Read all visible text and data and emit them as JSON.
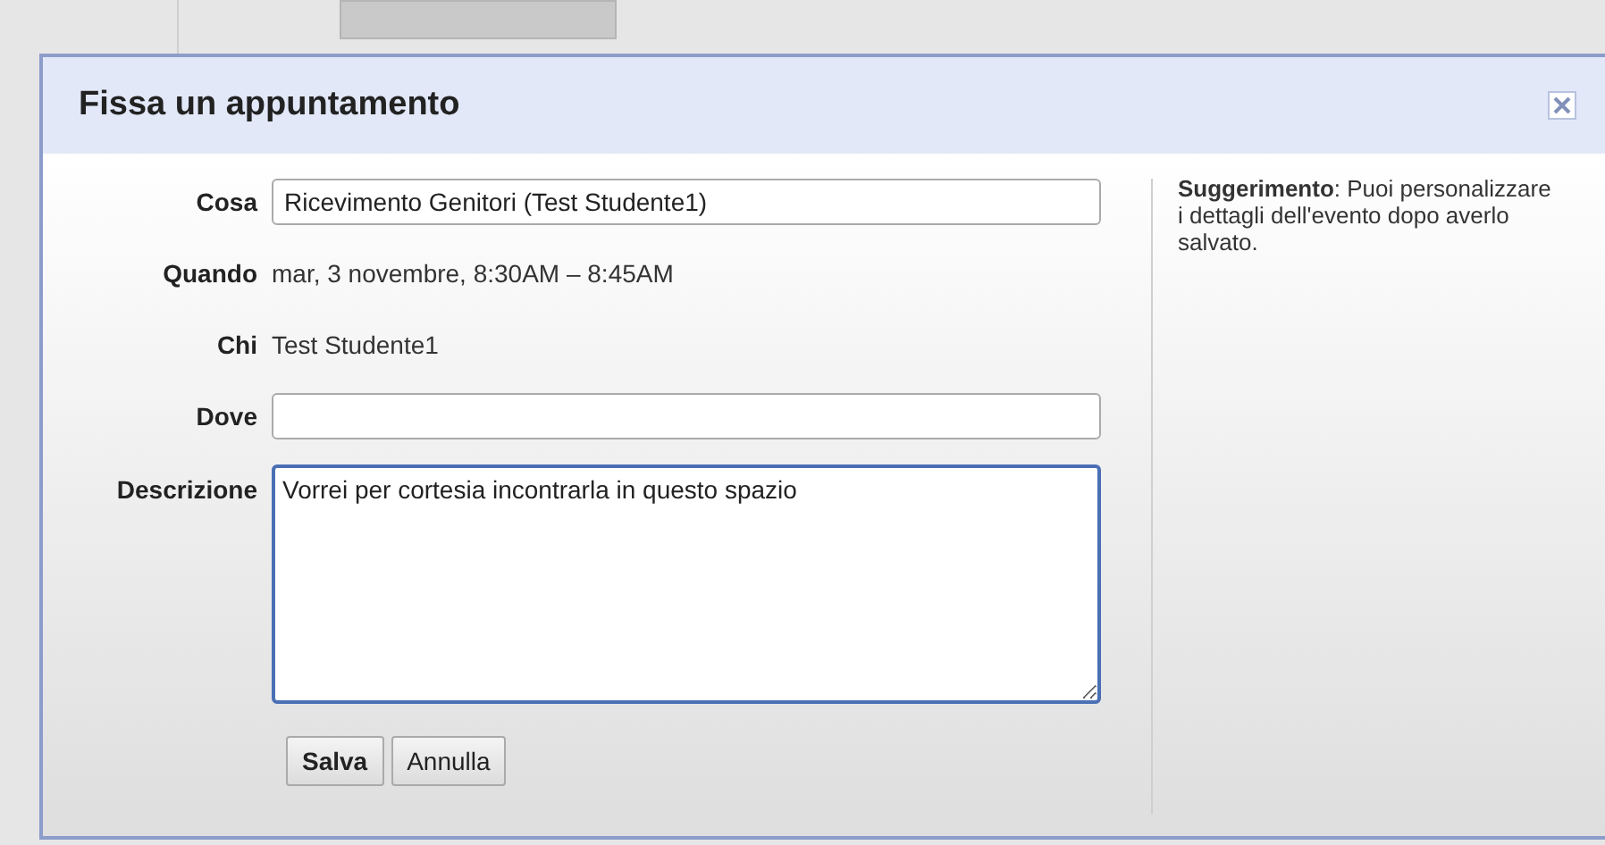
{
  "dialog": {
    "title": "Fissa un appuntamento"
  },
  "fields": [
    {
      "label": "Cosa",
      "kind": "input",
      "value": "Ricevimento Genitori (Test Studente1)"
    },
    {
      "label": "Quando",
      "kind": "text",
      "value": "mar, 3 novembre, 8:30AM – 8:45AM"
    },
    {
      "label": "Chi",
      "kind": "text",
      "value": "Test Studente1"
    },
    {
      "label": "Dove",
      "kind": "input"
    },
    {
      "label": "Descrizione",
      "kind": "textarea",
      "value": "Vorrei per cortesia incontrarla in questo spazio",
      "focused": true
    }
  ],
  "hint": "**Suggerimento**: Puoi personalizzare i dettagli dell'evento dopo averlo salvato.",
  "buttons": [
    {
      "label": "Salva",
      "primary": true
    },
    {
      "label": "Annulla",
      "primary": false
    }
  ]
}
